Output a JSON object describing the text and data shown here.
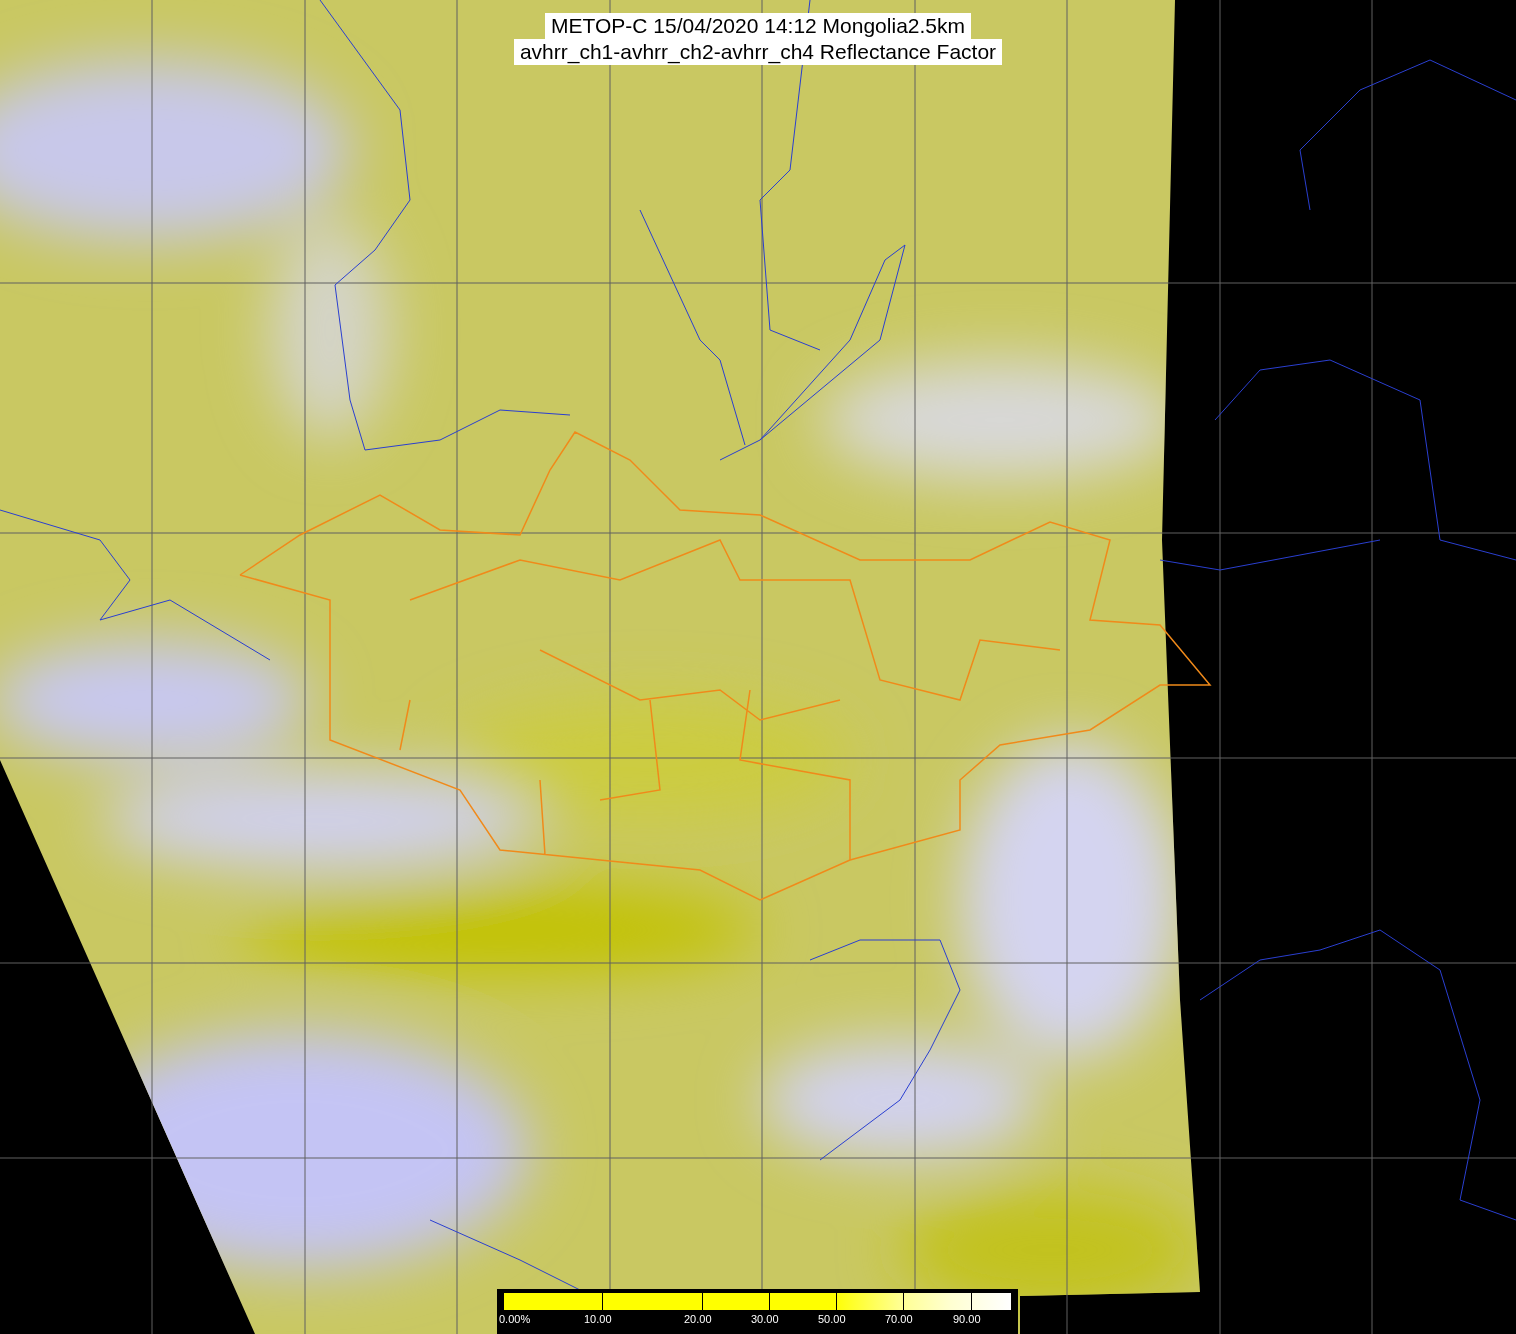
{
  "title": {
    "lines": [
      "METOP-C 15/04/2020 14:12 Mongolia2.5km",
      "avhrr_ch1-avhrr_ch2-avhrr_ch4 Reflectance Factor"
    ]
  },
  "colorbar": {
    "labels": [
      "0.00%",
      "10.00",
      "20.00",
      "30.00",
      "50.00",
      "70.00",
      "90.00"
    ]
  }
}
